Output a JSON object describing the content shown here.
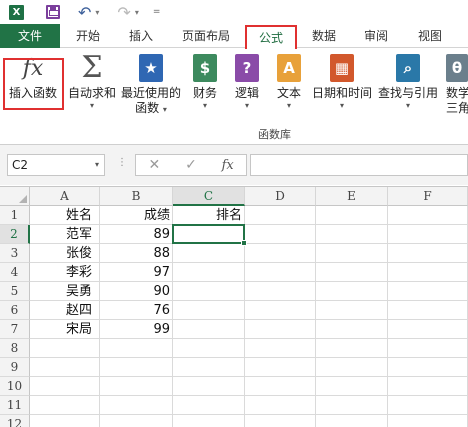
{
  "colors": {
    "file_tab": "#217346",
    "highlight": "#e03030",
    "sheet_green": "#217346"
  },
  "quick_access": {
    "logo": "X",
    "undo_icon": "↶",
    "redo_icon": "↷",
    "caret": "▾",
    "custom_caret": "="
  },
  "tabs": {
    "file": "文件",
    "home": "开始",
    "insert": "插入",
    "layout": "页面布局",
    "formula": "公式",
    "data": "数据",
    "review": "审阅",
    "view": "视图"
  },
  "ribbon": {
    "insert_function": {
      "icon": "fx",
      "label": "插入函数"
    },
    "autosum": {
      "icon": "Σ",
      "label": "自动求和",
      "caret": "▾"
    },
    "recent": {
      "icon": "★",
      "label1": "最近使用的",
      "label2": "函数",
      "caret": "▾"
    },
    "finance": {
      "icon": "$",
      "label": "财务",
      "caret": "▾"
    },
    "logic": {
      "icon": "?",
      "label": "逻辑",
      "caret": "▾"
    },
    "text": {
      "icon": "A",
      "label": "文本",
      "caret": "▾"
    },
    "datetime": {
      "icon": "▦",
      "label": "日期和时间",
      "caret": "▾"
    },
    "lookup": {
      "icon": "⌕",
      "label": "查找与引用",
      "caret": "▾"
    },
    "math": {
      "icon": "θ",
      "label1": "数学",
      "label2": "三角函"
    },
    "group_label": "函数库"
  },
  "formula_bar": {
    "name_box": "C2",
    "caret": "▾",
    "dots": "⋮",
    "cancel": "✕",
    "enter": "✓",
    "fx": "fx",
    "formula": ""
  },
  "sheet": {
    "columns": [
      "A",
      "B",
      "C",
      "D",
      "E",
      "F"
    ],
    "rows": [
      "1",
      "2",
      "3",
      "4",
      "5",
      "6",
      "7",
      "8",
      "9",
      "10",
      "11",
      "12"
    ],
    "headers": {
      "name": "姓名",
      "score": "成绩",
      "rank": "排名"
    },
    "records": [
      {
        "name": "范军",
        "score": "89"
      },
      {
        "name": "张俊",
        "score": "88"
      },
      {
        "name": "李彩",
        "score": "97"
      },
      {
        "name": "吴勇",
        "score": "90"
      },
      {
        "name": "赵四",
        "score": "76"
      },
      {
        "name": "宋局",
        "score": "99"
      }
    ],
    "active_cell": "C2"
  }
}
